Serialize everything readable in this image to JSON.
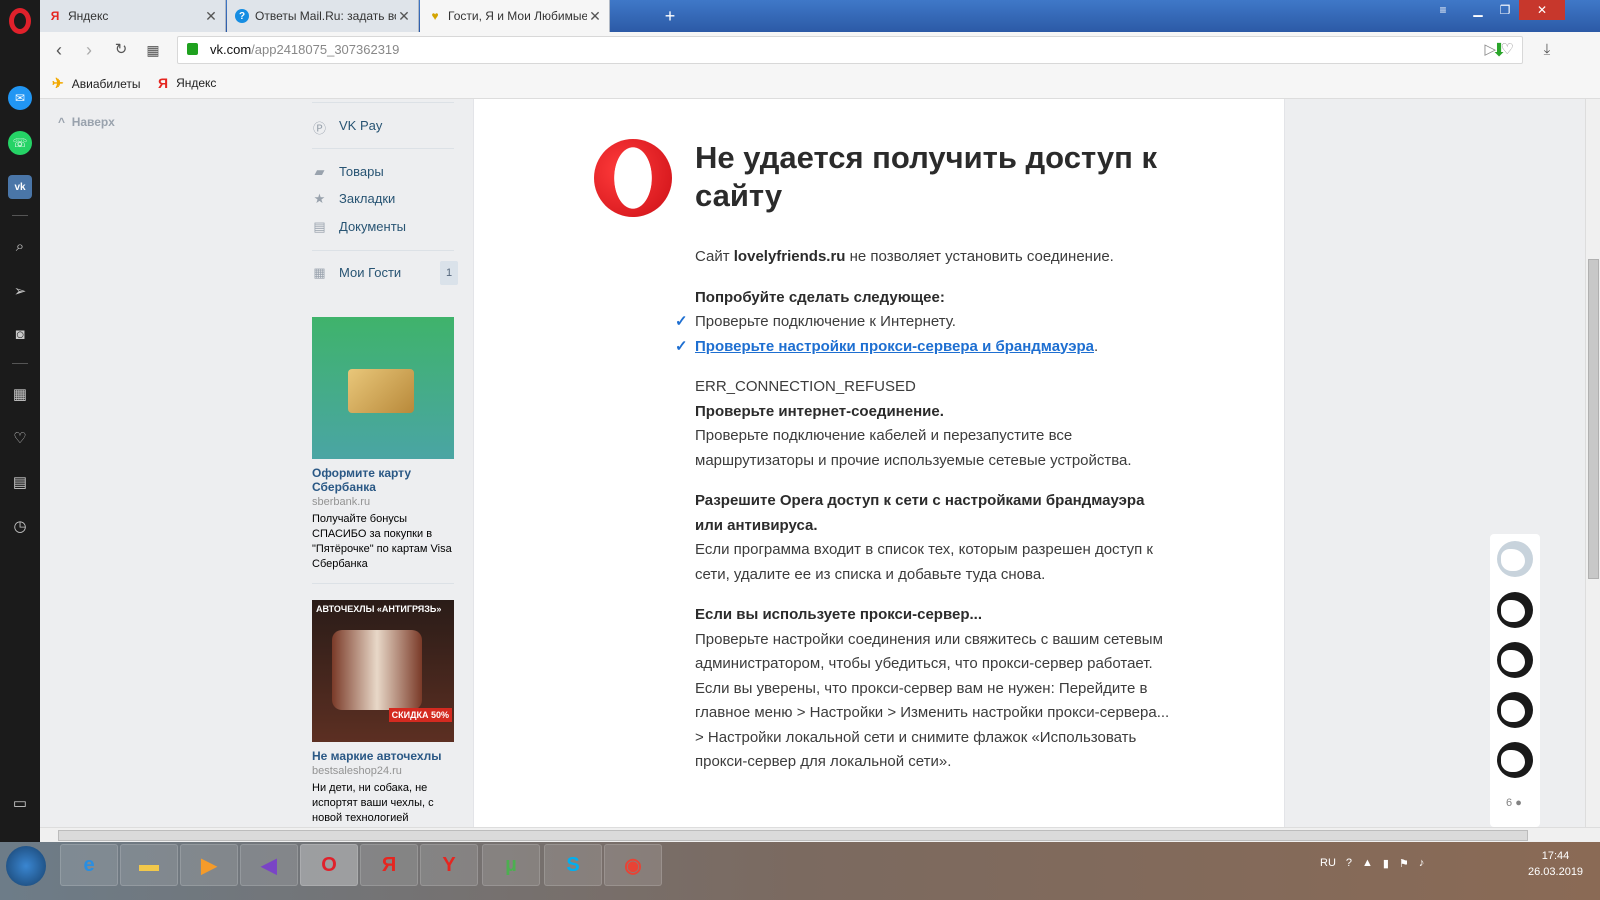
{
  "tabs": [
    {
      "label": "Яндекс",
      "favicon": "yandex-icon",
      "active": false
    },
    {
      "label": "Ответы Mail.Ru: задать во",
      "favicon": "question-icon",
      "active": false
    },
    {
      "label": "Гости, Я и Мои Любимые",
      "favicon": "heart-icon",
      "active": true
    }
  ],
  "address": {
    "host": "vk.com",
    "path": "/app2418075_307362319"
  },
  "bookmarks": [
    {
      "label": "Авиабилеты",
      "icon": "plane-icon"
    },
    {
      "label": "Яндекс",
      "icon": "yandex-icon"
    }
  ],
  "vk": {
    "top_link": "Наверх",
    "menu": [
      {
        "label": "VK Pay",
        "icon": "vkpay-icon"
      },
      {
        "label": "Товары",
        "icon": "bag-icon"
      },
      {
        "label": "Закладки",
        "icon": "star-icon"
      },
      {
        "label": "Документы",
        "icon": "document-icon"
      },
      {
        "label": "Мои Гости",
        "icon": "apps-icon"
      }
    ],
    "guests_badge": "1",
    "ads": [
      {
        "title": "Оформите карту Сбербанка",
        "domain": "sberbank.ru",
        "text": "Получайте бонусы СПАСИБО за покупки в \"Пятёрочке\" по картам Visa Сбербанка"
      },
      {
        "title": "Не маркие авточехлы",
        "domain": "bestsaleshop24.ru",
        "text": "Ни дети, ни собака, не испортят ваши чехлы, с новой технологией",
        "img_caption": "АВТОЧЕХЛЫ «АНТИГРЯЗЬ»",
        "img_badge": "СКИДКА 50%"
      }
    ],
    "guests_count": "6"
  },
  "error": {
    "title": "Не удается получить доступ к сайту",
    "site_prefix": "Сайт ",
    "site": "lovelyfriends.ru",
    "site_suffix": " не позволяет установить соединение.",
    "try_heading": "Попробуйте сделать следующее:",
    "check1": "Проверьте подключение к Интернету.",
    "check2_link": "Проверьте настройки прокси-сервера и брандмауэра",
    "check2_suffix": ".",
    "code": "ERR_CONNECTION_REFUSED",
    "h_internet": "Проверьте интернет-соединение.",
    "p_internet": "Проверьте подключение кабелей и перезапустите все маршрутизаторы и прочие используемые сетевые устройства.",
    "h_firewall": "Разрешите Opera доступ к сети с настройками брандмауэра или антивируса.",
    "p_firewall": "Если программа входит в список тех, которым разрешен доступ к сети, удалите ее из списка и добавьте туда снова.",
    "h_proxy": "Если вы используете прокси-сервер...",
    "p_proxy": "Проверьте настройки соединения или свяжитесь с вашим сетевым администратором, чтобы убедиться, что прокси-сервер работает. Если вы уверены, что прокси-сервер вам не нужен: Перейдите в главное меню > Настройки > Изменить настройки прокси-сервера... > Настройки локальной сети и снимите флажок «Использовать прокси-сервер для локальной сети»."
  },
  "taskbar": {
    "lang": "RU",
    "time": "17:44",
    "date": "26.03.2019"
  }
}
